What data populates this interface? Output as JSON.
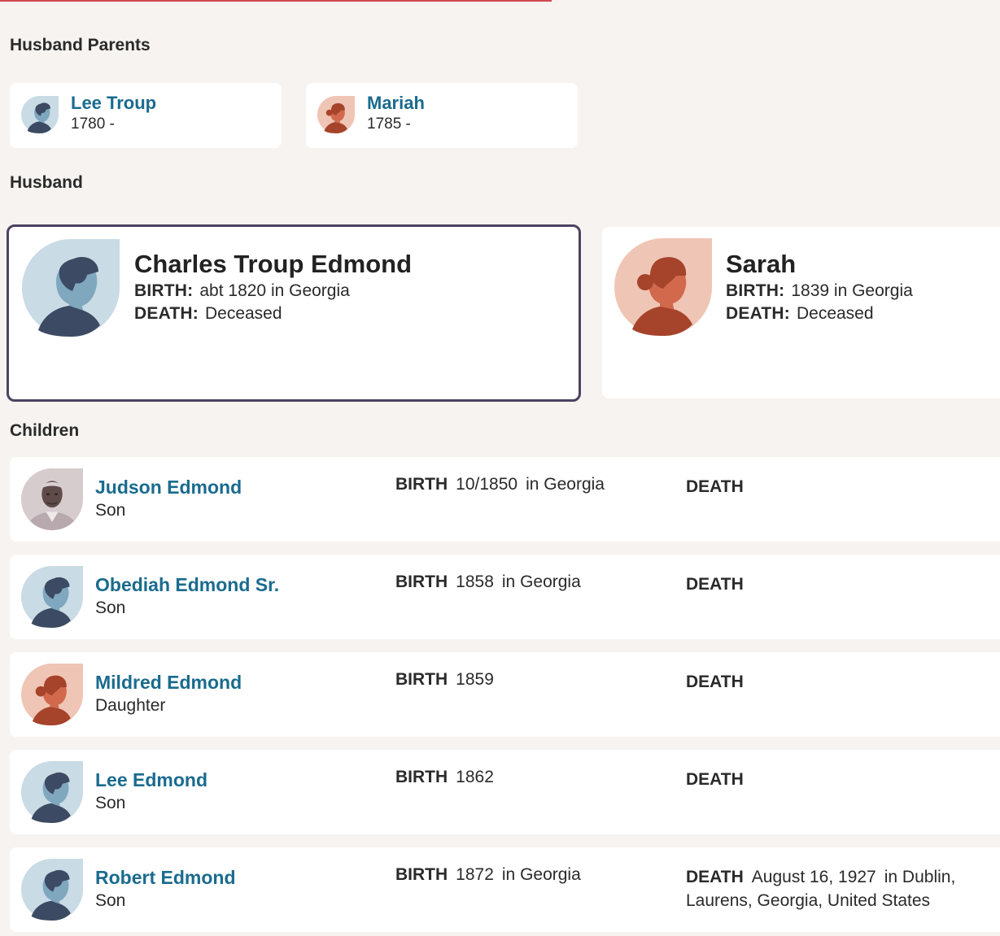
{
  "sections": {
    "husband_parents": "Husband Parents",
    "husband": "Husband",
    "children": "Children"
  },
  "husband_parents": [
    {
      "name": "Lee Troup",
      "dates": "1780 -",
      "gender": "male"
    },
    {
      "name": "Mariah",
      "dates": "1785 -",
      "gender": "female"
    }
  ],
  "husband": {
    "name": "Charles Troup Edmond",
    "birth_label": "BIRTH:",
    "birth_value": "abt 1820 in Georgia",
    "death_label": "DEATH:",
    "death_value": "Deceased"
  },
  "wife": {
    "name": "Sarah",
    "birth_label": "BIRTH:",
    "birth_value": "1839 in Georgia",
    "death_label": "DEATH:",
    "death_value": "Deceased"
  },
  "children": [
    {
      "name": "Judson Edmond",
      "relation": "Son",
      "birth_label": "BIRTH",
      "birth_date": "10/1850",
      "birth_place": "in Georgia",
      "death_label": "DEATH",
      "death_date": "",
      "death_place": "",
      "avatar": "photo"
    },
    {
      "name": "Obediah Edmond Sr.",
      "relation": "Son",
      "birth_label": "BIRTH",
      "birth_date": "1858",
      "birth_place": "in Georgia",
      "death_label": "DEATH",
      "death_date": "",
      "death_place": "",
      "avatar": "male"
    },
    {
      "name": "Mildred Edmond",
      "relation": "Daughter",
      "birth_label": "BIRTH",
      "birth_date": "1859",
      "birth_place": "",
      "death_label": "DEATH",
      "death_date": "",
      "death_place": "",
      "avatar": "female"
    },
    {
      "name": "Lee Edmond",
      "relation": "Son",
      "birth_label": "BIRTH",
      "birth_date": "1862",
      "birth_place": "",
      "death_label": "DEATH",
      "death_date": "",
      "death_place": "",
      "avatar": "male"
    },
    {
      "name": "Robert Edmond",
      "relation": "Son",
      "birth_label": "BIRTH",
      "birth_date": "1872",
      "birth_place": "in Georgia",
      "death_label": "DEATH",
      "death_date": "August 16, 1927",
      "death_place": "in Dublin, Laurens, Georgia, United States",
      "avatar": "male"
    }
  ],
  "colors": {
    "link": "#1a6b8e",
    "selected_border": "#4c4262",
    "male_bg": "#c9dbe4",
    "male_figure": "#3d4a63",
    "male_face": "#7fa7be",
    "female_bg": "#efc5b5",
    "female_figure": "#a6432b",
    "female_face": "#d2694d"
  }
}
